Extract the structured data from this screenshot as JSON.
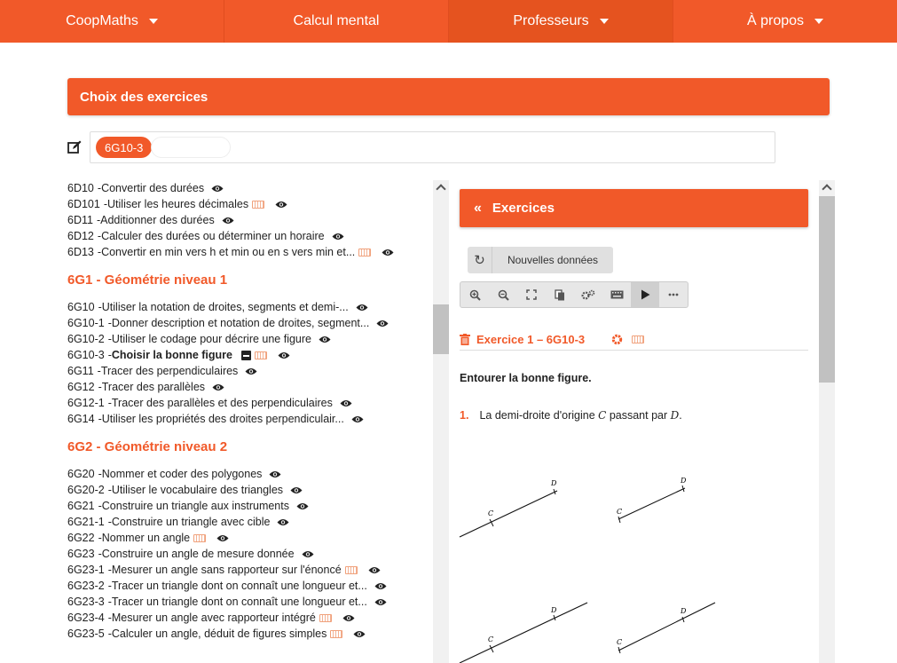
{
  "nav": {
    "items": [
      {
        "label": "CoopMaths",
        "dropdown": true
      },
      {
        "label": "Calcul mental",
        "dropdown": false
      },
      {
        "label": "Professeurs",
        "dropdown": true
      },
      {
        "label": "À propos",
        "dropdown": true
      }
    ]
  },
  "choix": {
    "title": "Choix des exercices"
  },
  "tags": {
    "selected": "6G10-3"
  },
  "list": {
    "group0": [
      {
        "code": "6D10",
        "label": "Convertir des durées",
        "kb": false
      },
      {
        "code": "6D101",
        "label": "Utiliser les heures décimales",
        "kb": true
      },
      {
        "code": "6D11",
        "label": "Additionner des durées",
        "kb": false
      },
      {
        "code": "6D12",
        "label": "Calculer des durées ou déterminer un horaire",
        "kb": false
      },
      {
        "code": "6D13",
        "label": "Convertir en min vers h et min ou en s vers min et...",
        "kb": true
      }
    ],
    "section1": "6G1 - Géométrie niveau 1",
    "group1": [
      {
        "code": "6G10",
        "label": "Utiliser la notation de droites, segments et demi-...",
        "kb": false
      },
      {
        "code": "6G10-1",
        "label": "Donner description et notation de droites, segment...",
        "kb": false
      },
      {
        "code": "6G10-2",
        "label": "Utiliser le codage pour décrire une figure",
        "kb": false
      },
      {
        "code": "6G10-3",
        "label": "Choisir la bonne figure",
        "kb": true,
        "selected": true
      },
      {
        "code": "6G11",
        "label": "Tracer des perpendiculaires",
        "kb": false
      },
      {
        "code": "6G12",
        "label": "Tracer des parallèles",
        "kb": false
      },
      {
        "code": "6G12-1",
        "label": "Tracer des parallèles et des perpendiculaires",
        "kb": false
      },
      {
        "code": "6G14",
        "label": "Utiliser les propriétés des droites perpendiculair...",
        "kb": false
      }
    ],
    "section2": "6G2 - Géométrie niveau 2",
    "group2": [
      {
        "code": "6G20",
        "label": "Nommer et coder des polygones",
        "kb": false
      },
      {
        "code": "6G20-2",
        "label": "Utiliser le vocabulaire des triangles",
        "kb": false
      },
      {
        "code": "6G21",
        "label": "Construire un triangle aux instruments",
        "kb": false
      },
      {
        "code": "6G21-1",
        "label": "Construire un triangle avec cible",
        "kb": false
      },
      {
        "code": "6G22",
        "label": "Nommer un angle",
        "kb": true
      },
      {
        "code": "6G23",
        "label": "Construire un angle de mesure donnée",
        "kb": false
      },
      {
        "code": "6G23-1",
        "label": "Mesurer un angle sans rapporteur sur l'énoncé",
        "kb": true
      },
      {
        "code": "6G23-2",
        "label": "Tracer un triangle dont on connaît une longueur et...",
        "kb": false
      },
      {
        "code": "6G23-3",
        "label": "Tracer un triangle dont on connaît une longueur et...",
        "kb": false
      },
      {
        "code": "6G23-4",
        "label": "Mesurer un angle avec rapporteur intégré",
        "kb": true
      },
      {
        "code": "6G23-5",
        "label": "Calculer un angle, déduit de figures simples",
        "kb": true
      }
    ]
  },
  "exercices": {
    "header": "Exercices",
    "new_data": "Nouvelles données",
    "ex_title": "Exercice 1 – 6G10-3",
    "consigne": "Entourer la bonne figure.",
    "q_num": "1.",
    "q_text_a": "La demi-droite d'origine ",
    "q_var1": "C",
    "q_text_b": " passant par ",
    "q_var2": "D",
    "q_text_c": ".",
    "point_c": "C",
    "point_d": "D"
  },
  "colors": {
    "accent": "#f15929"
  }
}
